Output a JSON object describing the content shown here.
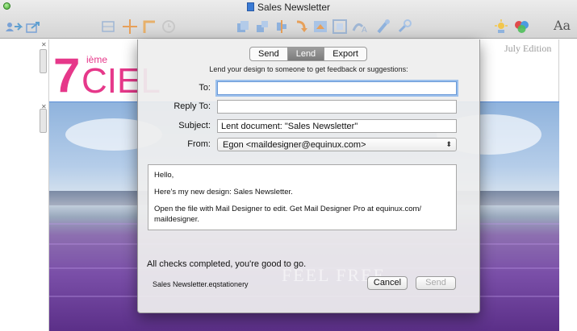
{
  "window": {
    "title": "Sales Newsletter",
    "aa_label": "Aa"
  },
  "toolbar": {
    "icons": [
      "person-share-icon",
      "share-icon",
      "layout-icon",
      "move-icon",
      "crop-icon",
      "clock-icon",
      "copy-icon",
      "paste-icon",
      "align-icon",
      "rotate-icon",
      "image-icon",
      "frame-icon",
      "text-style-icon",
      "brush-icon",
      "tools-icon",
      "effects-icon",
      "colors-icon"
    ]
  },
  "canvas": {
    "edition_label": "July Edition",
    "logo_number": "7",
    "logo_superscript": "ième",
    "logo_word": "CIEL",
    "watermark": "FEEL FREE"
  },
  "dialog": {
    "tabs": [
      {
        "label": "Send",
        "active": false
      },
      {
        "label": "Lend",
        "active": true
      },
      {
        "label": "Export",
        "active": false
      }
    ],
    "intro": "Lend your design to someone to get feedback or suggestions:",
    "to_label": "To:",
    "to_value": "",
    "replyto_label": "Reply To:",
    "replyto_value": "",
    "subject_label": "Subject:",
    "subject_value": "Lent document: \"Sales Newsletter\"",
    "from_label": "From:",
    "from_value": "Egon <maildesigner@equinux.com>",
    "message": {
      "greeting": "Hello,",
      "line1": "Here's my new design: Sales Newsletter.",
      "line2": "Open the file with Mail Designer to edit. Get Mail Designer Pro at equinux.com/ maildesigner."
    },
    "status": "All checks completed, you're good to go.",
    "filename": "Sales Newsletter.eqstationery",
    "cancel_label": "Cancel",
    "send_label": "Send"
  },
  "colors": {
    "accent": "#e6388a",
    "focus": "#6a9ad8"
  }
}
